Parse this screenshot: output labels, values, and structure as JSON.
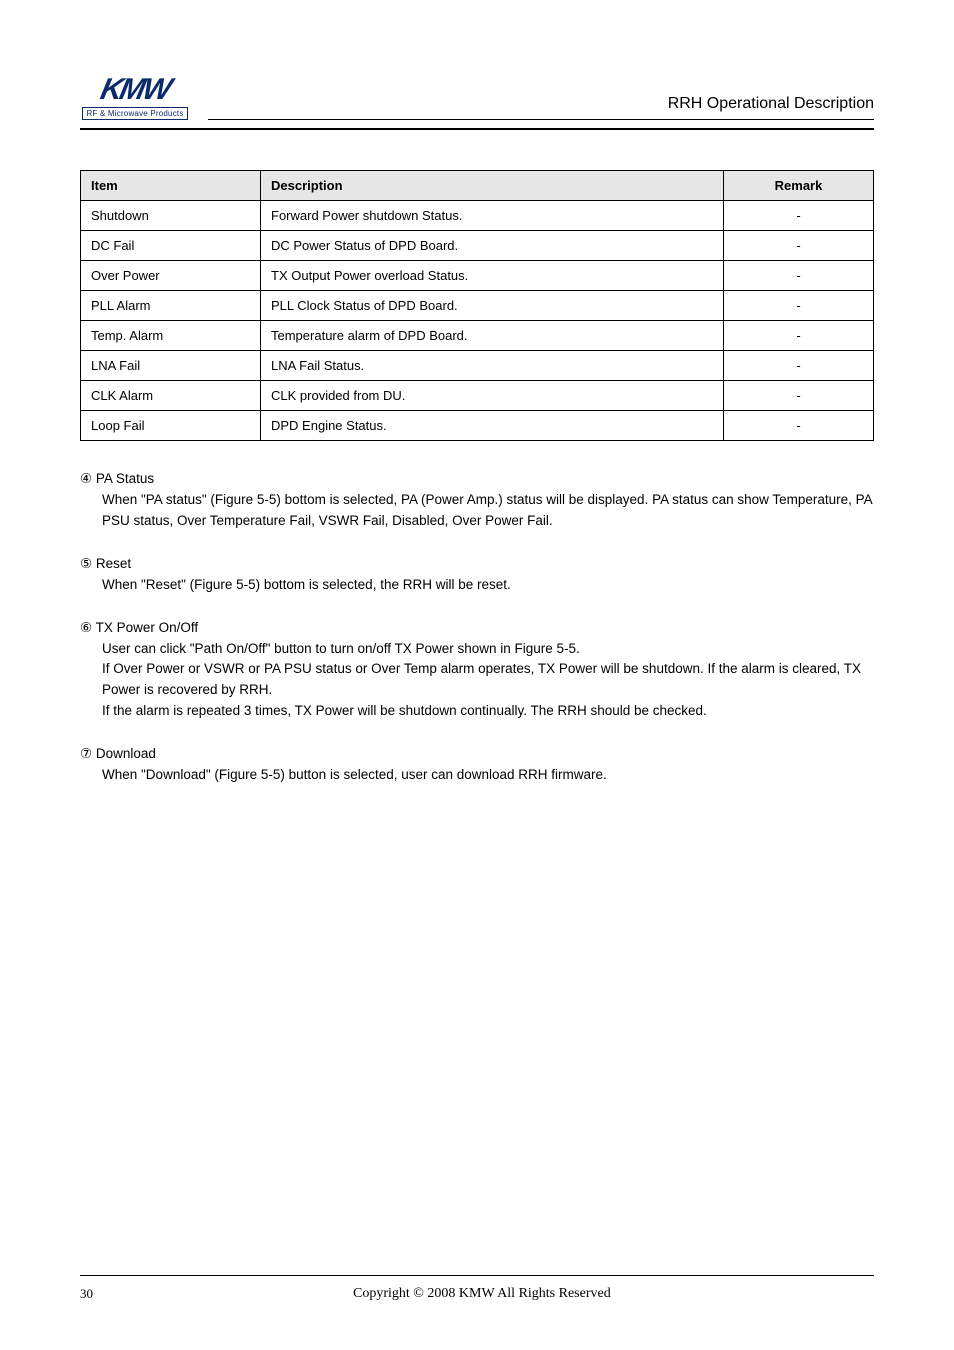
{
  "header": {
    "logo_line1": "KMW",
    "logo_line2": "RF & Microwave Products",
    "doc_title": "RRH Operational Description"
  },
  "table": {
    "headers": [
      "Item",
      "Description",
      "Remark"
    ],
    "rows": [
      [
        "Shutdown",
        "Forward Power shutdown Status.",
        "-"
      ],
      [
        "DC Fail",
        "DC Power Status of DPD Board.",
        "-"
      ],
      [
        "Over Power",
        "TX Output Power overload Status.",
        "-"
      ],
      [
        "PLL Alarm",
        "PLL Clock Status of DPD Board.",
        "-"
      ],
      [
        "Temp. Alarm",
        "Temperature alarm of DPD Board.",
        "-"
      ],
      [
        "LNA Fail",
        "LNA Fail Status.",
        "-"
      ],
      [
        "CLK Alarm",
        "CLK provided from DU.",
        "-"
      ],
      [
        "Loop Fail",
        "DPD Engine Status.",
        "-"
      ]
    ]
  },
  "sections": {
    "s4": {
      "num": "④",
      "title": "PA Status",
      "body": "When \"PA status\" (Figure 5-5) bottom is selected, PA (Power Amp.) status will be displayed. PA status can show Temperature, PA PSU status, Over Temperature Fail, VSWR Fail, Disabled, Over Power Fail."
    },
    "s5": {
      "num": "⑤",
      "title": "Reset",
      "body": "When \"Reset\" (Figure 5-5) bottom is selected, the RRH will be reset."
    },
    "s6": {
      "num": "⑥",
      "title": "TX Power On/Off",
      "body1": "User can click \"Path On/Off\" button to turn on/off TX Power shown in Figure 5-5.",
      "body2": "If Over Power or VSWR or PA PSU status or Over Temp alarm operates, TX Power will be shutdown. If the alarm is cleared, TX Power is recovered by RRH.",
      "body3": "If the alarm is repeated 3 times, TX Power will be shutdown continually. The RRH should be checked."
    },
    "s7": {
      "num": "⑦",
      "title": "Download",
      "body": "When \"Download\" (Figure 5-5) button is selected, user can download RRH firmware."
    }
  },
  "footer": {
    "copyright": "Copyright © 2008 KMW All Rights Reserved",
    "page": "30"
  }
}
